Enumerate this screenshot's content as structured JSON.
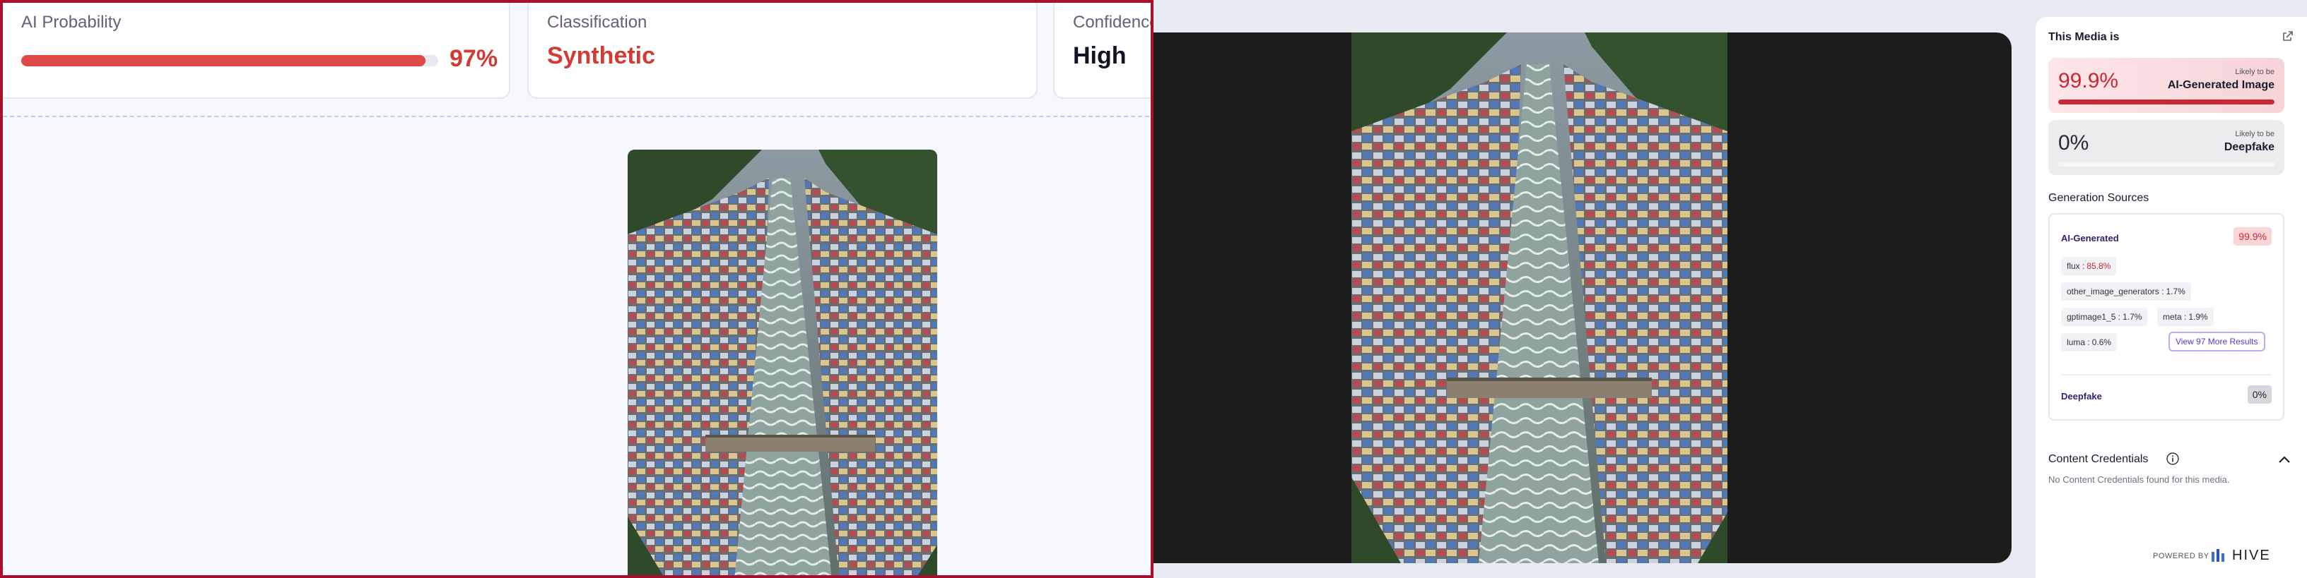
{
  "metrics": {
    "ai_probability": {
      "title": "AI Probability",
      "value": "97%",
      "fraction": 0.97
    },
    "classification": {
      "title": "Classification",
      "value": "Synthetic"
    },
    "confidence": {
      "title": "Confidence",
      "value": "High"
    }
  },
  "sidebar": {
    "title": "This Media is",
    "ai_generated": {
      "percent": "99.9%",
      "fraction": 0.999,
      "small": "Likely to be",
      "label": "AI-Generated Image"
    },
    "deepfake": {
      "percent": "0%",
      "fraction": 0.0,
      "small": "Likely to be",
      "label": "Deepfake"
    },
    "generation_sources": {
      "heading": "Generation Sources",
      "ai_generated": {
        "label": "AI-Generated",
        "value": "99.9%"
      },
      "chips": [
        {
          "name": "flux",
          "value": "85.8%"
        },
        {
          "name": "other_image_generators",
          "value": "1.7%"
        },
        {
          "name": "gptimage1_5",
          "value": "1.7%"
        },
        {
          "name": "meta",
          "value": "1.9%"
        },
        {
          "name": "luma",
          "value": "0.6%"
        }
      ],
      "view_more": "View 97 More Results",
      "deepfake": {
        "label": "Deepfake",
        "value": "0%"
      }
    },
    "content_credentials": {
      "heading": "Content Credentials",
      "text": "No Content Credentials found for this media."
    },
    "footer": {
      "powered_by": "POWERED BY",
      "brand": "HIVE"
    }
  },
  "colors": {
    "accent_red": "#c92837",
    "bar_red": "#de4a45",
    "frame_border": "#a8102e",
    "link_purple": "#4a3fd6"
  },
  "icons": [
    "external-link-icon",
    "info-icon",
    "chevron-up-icon",
    "hive-logo-icon"
  ]
}
